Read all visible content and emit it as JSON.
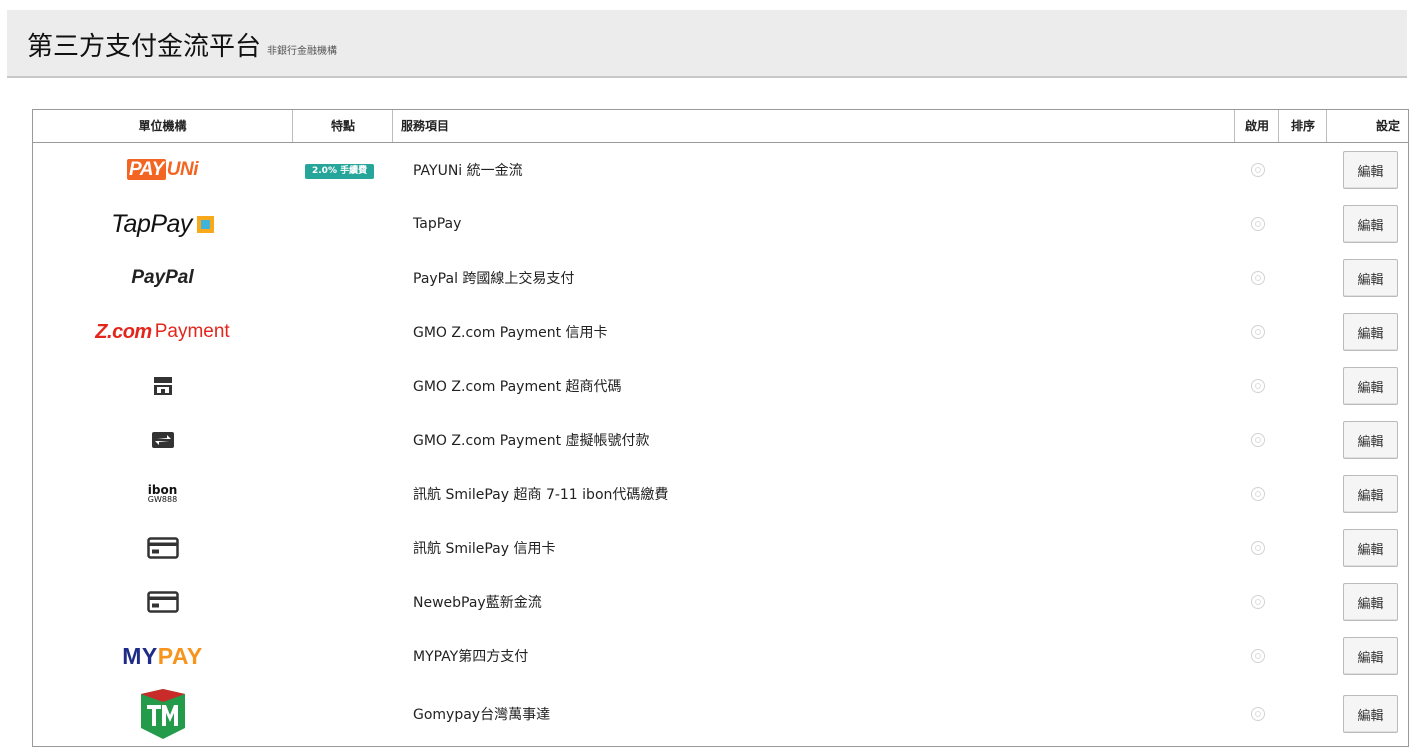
{
  "header": {
    "title": "第三方支付金流平台",
    "subtitle": "非銀行金融機構"
  },
  "columns": {
    "unit": "單位機構",
    "feature": "特點",
    "service": "服務項目",
    "enable": "啟用",
    "order": "排序",
    "settings": "設定"
  },
  "edit_label": "編輯",
  "colors": {
    "badge": "#26a69a",
    "payuni_orange": "#f26522",
    "zcom_red": "#e3261d",
    "mypay_blue": "#1f2c87",
    "mypay_orange": "#f7941d",
    "tm_green": "#239b4a",
    "tm_red": "#c92a2a"
  },
  "rows": [
    {
      "logo_icon": "payuni-logo",
      "logo": {
        "a": "PAY",
        "b": "UNi"
      },
      "badge": "2.0% 手續費",
      "service": "PAYUNi 統一金流"
    },
    {
      "logo_icon": "tappay-logo",
      "logo": {
        "a": "TapPay"
      },
      "service": "TapPay"
    },
    {
      "logo_icon": "paypal-logo",
      "logo": {
        "a": "PayPal"
      },
      "service": "PayPal 跨國線上交易支付"
    },
    {
      "logo_icon": "zcom-payment-logo",
      "logo": {
        "a": "Z.com",
        "b": "Payment"
      },
      "service": "GMO Z.com Payment 信用卡"
    },
    {
      "logo_icon": "store-icon",
      "service": "GMO Z.com Payment 超商代碼"
    },
    {
      "logo_icon": "transfer-icon",
      "service": "GMO Z.com Payment 虛擬帳號付款"
    },
    {
      "logo_icon": "ibon-logo",
      "logo": {
        "a": "ibon",
        "b": "GW888"
      },
      "service": "訊航 SmilePay 超商 7-11 ibon代碼繳費"
    },
    {
      "logo_icon": "credit-card-icon",
      "service": "訊航 SmilePay 信用卡"
    },
    {
      "logo_icon": "credit-card-icon",
      "service": "NewebPay藍新金流"
    },
    {
      "logo_icon": "mypay-logo",
      "logo": {
        "a": "MY",
        "b": "PAY"
      },
      "service": "MYPAY第四方支付"
    },
    {
      "logo_icon": "tm-logo",
      "service": "Gomypay台灣萬事達"
    }
  ]
}
